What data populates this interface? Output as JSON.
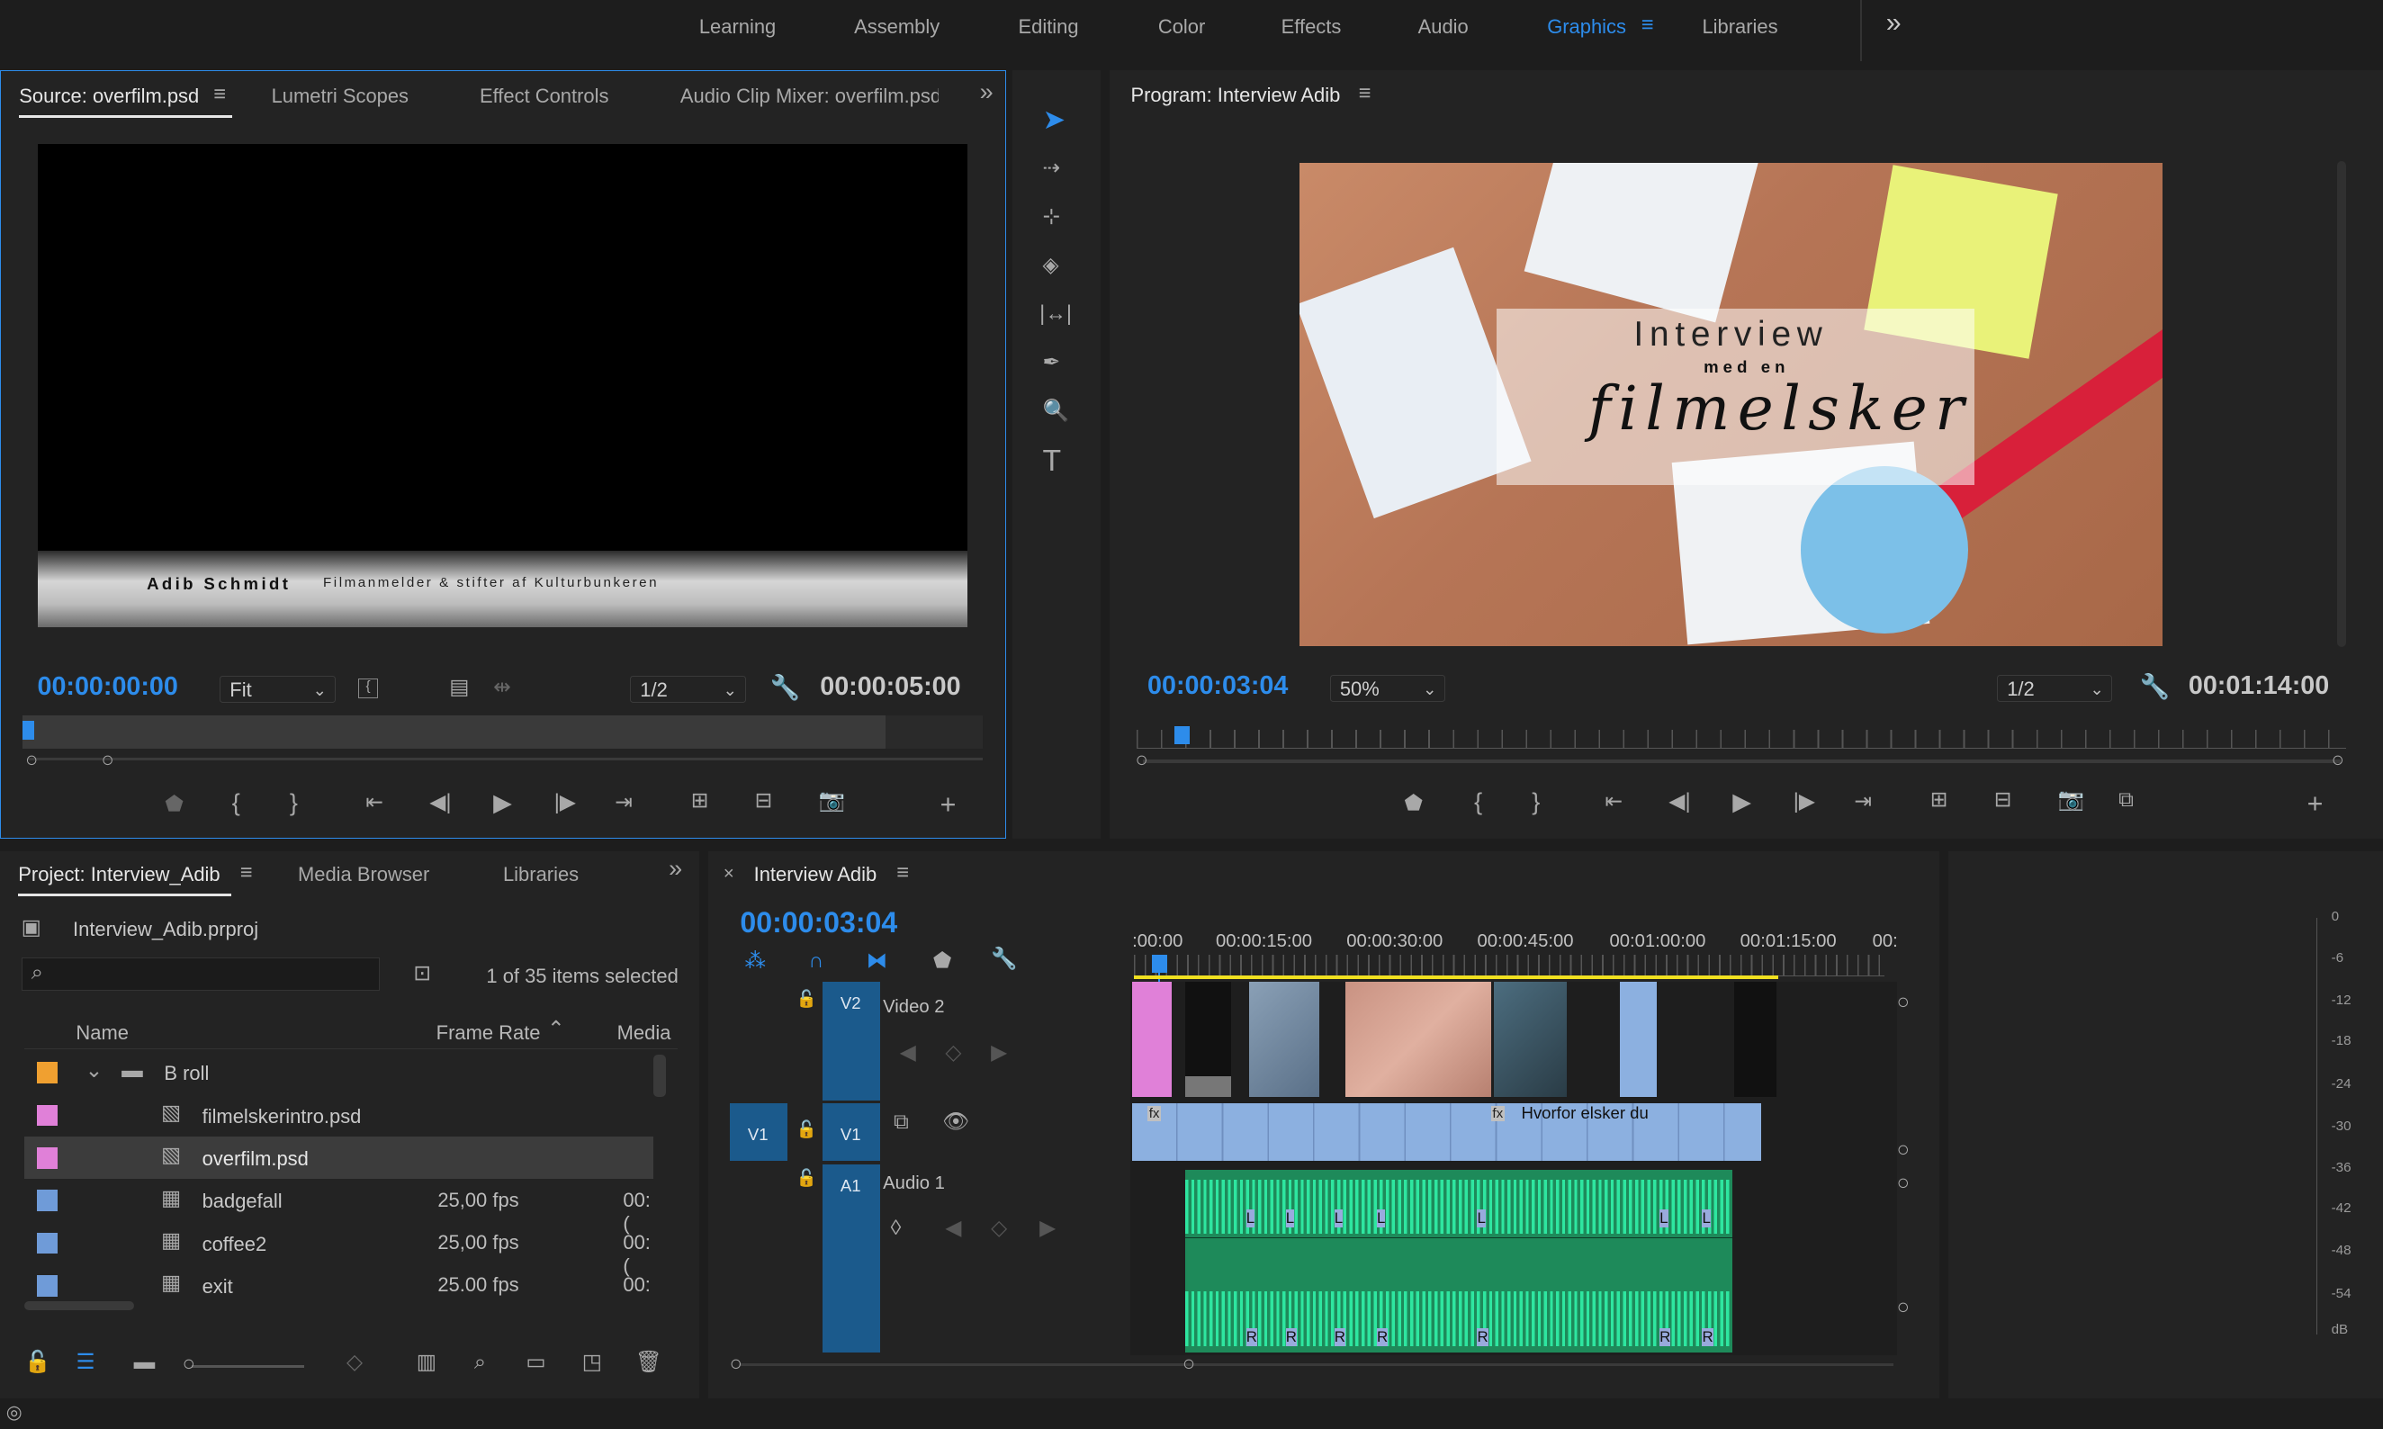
{
  "workspace": {
    "tabs": [
      "Learning",
      "Assembly",
      "Editing",
      "Color",
      "Effects",
      "Audio",
      "Graphics",
      "Libraries"
    ],
    "active": "Graphics",
    "more": "»"
  },
  "source_panel": {
    "tabs": [
      "Source: overfilm.psd",
      "Lumetri Scopes",
      "Effect Controls",
      "Audio Clip Mixer: overfilm.psd"
    ],
    "timecode_in": "00:00:00:00",
    "timecode_duration": "00:00:05:00",
    "zoom": "Fit",
    "resolution": "1/2",
    "lower_third_name": "Adib Schmidt",
    "lower_third_title": "Filmanmelder & stifter af Kulturbunkeren"
  },
  "program_panel": {
    "title": "Program: Interview Adib",
    "timecode": "00:00:03:04",
    "zoom": "50%",
    "resolution": "1/2",
    "duration": "00:01:14:00",
    "overlay_line1": "Interview",
    "overlay_line2": "med en",
    "overlay_line3": "filmelsker"
  },
  "project_panel": {
    "tabs": [
      "Project: Interview_Adib",
      "Media Browser",
      "Libraries"
    ],
    "project_file": "Interview_Adib.prproj",
    "selection_status": "1 of 35 items selected",
    "columns": [
      "Name",
      "Frame Rate",
      "Media"
    ],
    "items": [
      {
        "name": "B roll",
        "fps": "",
        "media": "",
        "color": "#f0a030",
        "type": "bin"
      },
      {
        "name": "filmelskerintro.psd",
        "fps": "",
        "media": "",
        "color": "#e080d8",
        "type": "psd"
      },
      {
        "name": "overfilm.psd",
        "fps": "",
        "media": "",
        "color": "#e080d8",
        "type": "psd",
        "selected": true
      },
      {
        "name": "badgefall",
        "fps": "25,00 fps",
        "media": "00:(",
        "color": "#6f9bd8",
        "type": "clip"
      },
      {
        "name": "coffee2",
        "fps": "25,00 fps",
        "media": "00:(",
        "color": "#6f9bd8",
        "type": "clip"
      },
      {
        "name": "exit",
        "fps": "25.00 fps",
        "media": "00:(",
        "color": "#6f9bd8",
        "type": "clip"
      }
    ]
  },
  "timeline": {
    "sequence_name": "Interview Adib",
    "timecode": "00:00:03:04",
    "ruler": [
      ":00:00",
      "00:00:15:00",
      "00:00:30:00",
      "00:00:45:00",
      "00:01:00:00",
      "00:01:15:00",
      "00:"
    ],
    "tracks": {
      "v2": {
        "id": "V2",
        "name": "Video 2"
      },
      "v1": {
        "id": "V1",
        "src": "V1"
      },
      "a1": {
        "id": "A1",
        "name": "Audio 1"
      }
    },
    "clip_label": "Hvorfor elsker du",
    "fx": "fx",
    "audio_left": "L",
    "audio_right": "R"
  },
  "audio_meter": {
    "labels": [
      "0",
      "-6",
      "-12",
      "-18",
      "-24",
      "-30",
      "-36",
      "-42",
      "-48",
      "-54",
      "dB"
    ]
  },
  "colors": {
    "accent_blue": "#2d8ceb",
    "panel_bg": "#232323",
    "clip_blue": "#8cb0e0",
    "audio_green": "#1e8a5a",
    "audio_wave": "#2ee6a0",
    "psd_pink": "#e080d8",
    "bin_orange": "#f0a030"
  }
}
